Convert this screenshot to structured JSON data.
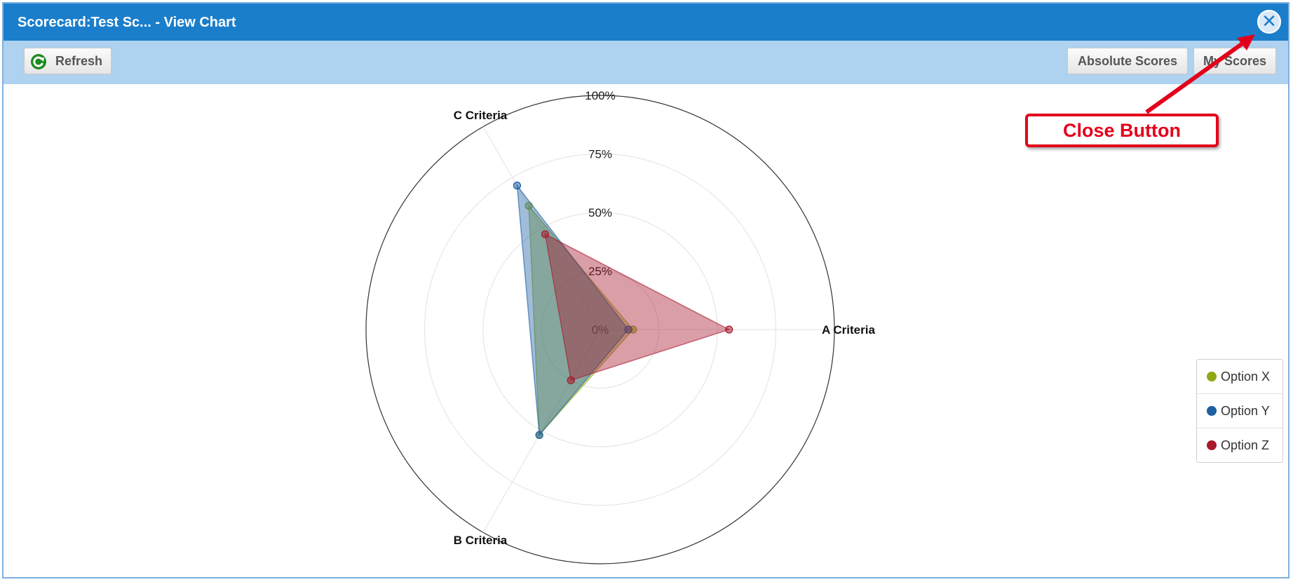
{
  "window": {
    "title": "Scorecard:Test Sc... - View Chart",
    "close_icon": "close-icon"
  },
  "toolbar": {
    "refresh_label": "Refresh",
    "refresh_icon": "refresh-icon",
    "absolute_scores_label": "Absolute Scores",
    "my_scores_label": "My Scores"
  },
  "annotation": {
    "callout_text": "Close Button",
    "color": "#e3001b"
  },
  "colors": {
    "titlebar": "#1a7ecb",
    "toolbar": "#aed2ef"
  },
  "chart_data": {
    "type": "radar",
    "axes": [
      "A Criteria",
      "B Criteria",
      "C Criteria"
    ],
    "radial_ticks": [
      "0%",
      "25%",
      "50%",
      "75%",
      "100%"
    ],
    "rmax": 100,
    "series": [
      {
        "name": "Option X",
        "color": "#8fa914",
        "values": [
          14,
          52,
          61
        ]
      },
      {
        "name": "Option Y",
        "color": "#1d5fa3",
        "values": [
          12,
          52,
          71
        ]
      },
      {
        "name": "Option Z",
        "color": "#a8192e",
        "values": [
          55,
          25,
          47
        ]
      }
    ],
    "legend_position": "right"
  }
}
